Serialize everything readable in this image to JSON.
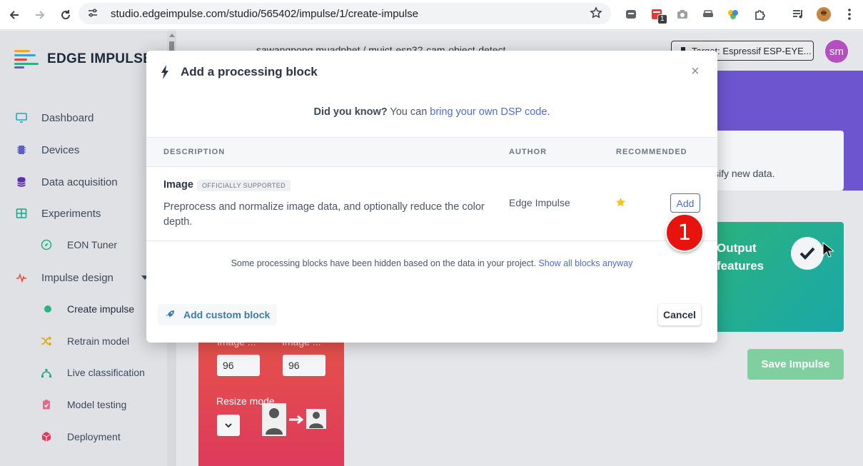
{
  "browser": {
    "url": "studio.edgeimpulse.com/studio/565402/impulse/1/create-impulse",
    "extension_badge": "1"
  },
  "sidebar": {
    "logo_text": "EDGE IMPULSE",
    "items": [
      {
        "label": "Dashboard",
        "icon": "monitor-icon"
      },
      {
        "label": "Devices",
        "icon": "chip-icon"
      },
      {
        "label": "Data acquisition",
        "icon": "database-icon"
      },
      {
        "label": "Experiments",
        "icon": "grid-icon"
      },
      {
        "label": "EON Tuner",
        "icon": "compass-icon"
      },
      {
        "label": "Impulse design",
        "icon": "pulse-icon"
      },
      {
        "label": "Create impulse",
        "icon": "dot-icon"
      },
      {
        "label": "Retrain model",
        "icon": "shuffle-icon"
      },
      {
        "label": "Live classification",
        "icon": "bezier-icon"
      },
      {
        "label": "Model testing",
        "icon": "clipboard-icon"
      },
      {
        "label": "Deployment",
        "icon": "cube-icon"
      }
    ]
  },
  "header": {
    "breadcrumb": "sawangpong.muadphet / muict-esp32-cam-object-detect",
    "target": "Target: Espressif ESP-EYE...",
    "avatar_initials": "sm"
  },
  "background": {
    "info_text": "sify new data.",
    "output_title_1": "Output",
    "output_title_2": "features",
    "save_label": "Save Impulse",
    "image_width_label": "Image ...",
    "image_height_label": "Image ...",
    "image_width": "96",
    "image_height": "96",
    "resize_mode_label": "Resize mode"
  },
  "modal": {
    "title": "Add a processing block",
    "close": "×",
    "did_you_know": "Did you know?",
    "you_can": " You can ",
    "link": "bring your own DSP code",
    "period": ".",
    "columns": [
      "DESCRIPTION",
      "AUTHOR",
      "RECOMMENDED"
    ],
    "block": {
      "name": "Image",
      "badge": "OFFICIALLY SUPPORTED",
      "description": "Preprocess and normalize image data, and optionally reduce the color depth.",
      "author": "Edge Impulse",
      "add_label": "Add"
    },
    "hidden_note": "Some processing blocks have been hidden based on the data in your project. ",
    "show_all": "Show all blocks anyway",
    "custom_block": "Add custom block",
    "cancel": "Cancel"
  },
  "annotation": {
    "number": "1",
    "color": "#e8120f"
  },
  "colors": {
    "accent": "#4b6bd6",
    "purple": "#6e55d0",
    "green": "#2bb37e",
    "red": "#e5534a"
  }
}
